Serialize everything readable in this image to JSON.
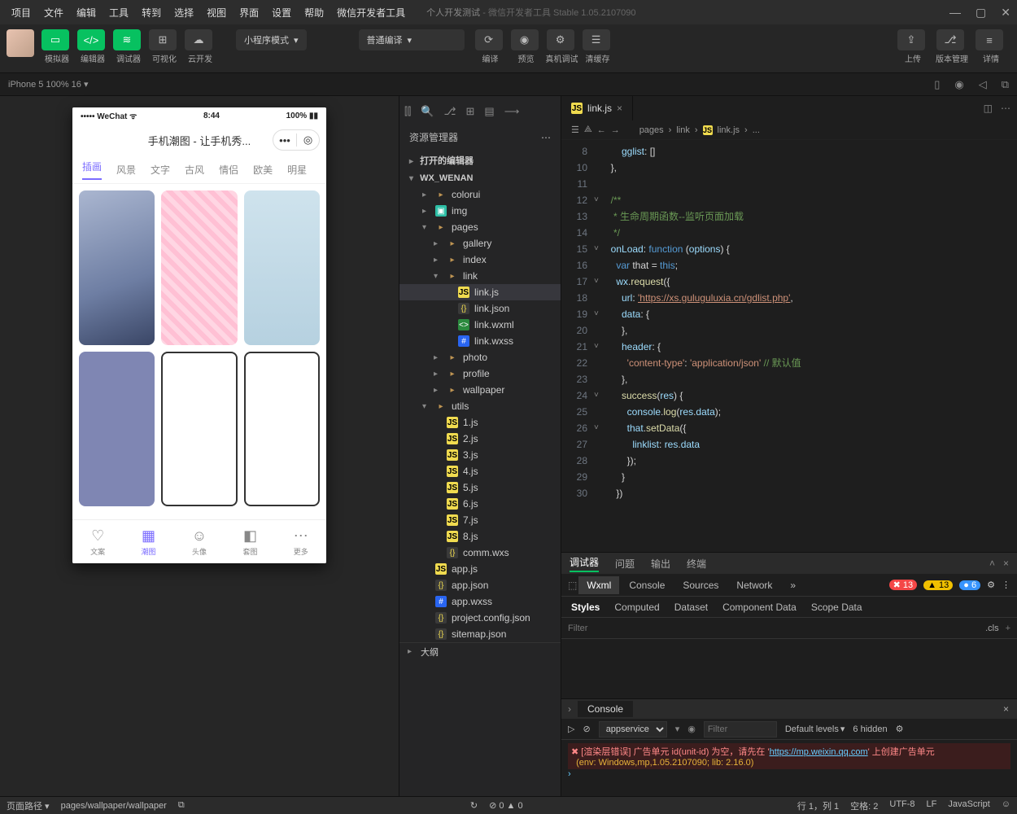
{
  "title": {
    "app": "个人开发测试",
    "suffix": " - 微信开发者工具 Stable 1.05.2107090"
  },
  "menu": [
    "项目",
    "文件",
    "编辑",
    "工具",
    "转到",
    "选择",
    "视图",
    "界面",
    "设置",
    "帮助",
    "微信开发者工具"
  ],
  "toolbar": {
    "sim": "模拟器",
    "editor": "编辑器",
    "debugger": "调试器",
    "viz": "可视化",
    "cloud": "云开发",
    "mode": "小程序模式",
    "compileMode": "普通编译",
    "compile": "编译",
    "preview": "预览",
    "realdev": "真机调试",
    "clear": "清缓存",
    "upload": "上传",
    "version": "版本管理",
    "details": "详情"
  },
  "device": {
    "label": "iPhone 5 100% 16"
  },
  "phone": {
    "carrier": "WeChat",
    "time": "8:44",
    "battery": "100%",
    "title": "手机潮图 - 让手机秀...",
    "tabs": [
      "插画",
      "风景",
      "文字",
      "古风",
      "情侣",
      "欧美",
      "明星"
    ],
    "tabbar": [
      {
        "icon": "♡",
        "label": "文案"
      },
      {
        "icon": "▦",
        "label": "潮图"
      },
      {
        "icon": "☺",
        "label": "头像"
      },
      {
        "icon": "◧",
        "label": "套图"
      },
      {
        "icon": "⋯",
        "label": "更多"
      }
    ]
  },
  "explorer": {
    "title": "资源管理器",
    "sections": {
      "openEditors": "打开的编辑器",
      "project": "WX_WENAN"
    },
    "tree": [
      {
        "d": 1,
        "t": "folder",
        "c": "▸",
        "n": "colorui"
      },
      {
        "d": 1,
        "t": "img",
        "c": "▸",
        "n": "img"
      },
      {
        "d": 1,
        "t": "folder",
        "c": "▾",
        "n": "pages"
      },
      {
        "d": 2,
        "t": "folder",
        "c": "▸",
        "n": "gallery"
      },
      {
        "d": 2,
        "t": "folder",
        "c": "▸",
        "n": "index"
      },
      {
        "d": 2,
        "t": "folder",
        "c": "▾",
        "n": "link"
      },
      {
        "d": 3,
        "t": "js",
        "n": "link.js",
        "sel": true
      },
      {
        "d": 3,
        "t": "json",
        "n": "link.json"
      },
      {
        "d": 3,
        "t": "wxml",
        "n": "link.wxml"
      },
      {
        "d": 3,
        "t": "wxss",
        "n": "link.wxss"
      },
      {
        "d": 2,
        "t": "folder",
        "c": "▸",
        "n": "photo"
      },
      {
        "d": 2,
        "t": "folder",
        "c": "▸",
        "n": "profile"
      },
      {
        "d": 2,
        "t": "folder",
        "c": "▸",
        "n": "wallpaper"
      },
      {
        "d": 1,
        "t": "folder",
        "c": "▾",
        "n": "utils"
      },
      {
        "d": 2,
        "t": "js",
        "n": "1.js"
      },
      {
        "d": 2,
        "t": "js",
        "n": "2.js"
      },
      {
        "d": 2,
        "t": "js",
        "n": "3.js"
      },
      {
        "d": 2,
        "t": "js",
        "n": "4.js"
      },
      {
        "d": 2,
        "t": "js",
        "n": "5.js"
      },
      {
        "d": 2,
        "t": "js",
        "n": "6.js"
      },
      {
        "d": 2,
        "t": "js",
        "n": "7.js"
      },
      {
        "d": 2,
        "t": "js",
        "n": "8.js"
      },
      {
        "d": 2,
        "t": "json",
        "n": "comm.wxs"
      },
      {
        "d": 1,
        "t": "js",
        "n": "app.js"
      },
      {
        "d": 1,
        "t": "json",
        "n": "app.json"
      },
      {
        "d": 1,
        "t": "wxss",
        "n": "app.wxss"
      },
      {
        "d": 1,
        "t": "json",
        "n": "project.config.json"
      },
      {
        "d": 1,
        "t": "json",
        "n": "sitemap.json"
      }
    ],
    "outline": "大纲"
  },
  "editor": {
    "tab": "link.js",
    "crumbs": [
      "pages",
      "link",
      "link.js",
      "..."
    ],
    "lines": [
      {
        "n": 8,
        "frag": [
          [
            "prop",
            "      gglist"
          ],
          [
            "punct",
            ": []"
          ]
        ]
      },
      {
        "n": 10,
        "frag": [
          [
            "punct",
            "  },"
          ]
        ]
      },
      {
        "n": 11,
        "frag": [
          [
            "punct",
            ""
          ]
        ]
      },
      {
        "n": 12,
        "frag": [
          [
            "comment",
            "  /**"
          ]
        ]
      },
      {
        "n": 13,
        "frag": [
          [
            "comment",
            "   * 生命周期函数--监听页面加载"
          ]
        ]
      },
      {
        "n": 14,
        "frag": [
          [
            "comment",
            "   */"
          ]
        ]
      },
      {
        "n": 15,
        "frag": [
          [
            "prop",
            "  onLoad"
          ],
          [
            "punct",
            ": "
          ],
          [
            "key",
            "function"
          ],
          [
            "punct",
            " ("
          ],
          [
            "prop",
            "options"
          ],
          [
            "punct",
            ") {"
          ]
        ]
      },
      {
        "n": 16,
        "frag": [
          [
            "key",
            "    var"
          ],
          [
            "punct",
            " that = "
          ],
          [
            "key",
            "this"
          ],
          [
            "punct",
            ";"
          ]
        ]
      },
      {
        "n": 17,
        "frag": [
          [
            "prop",
            "    wx"
          ],
          [
            "punct",
            "."
          ],
          [
            "func",
            "request"
          ],
          [
            "punct",
            "({"
          ]
        ]
      },
      {
        "n": 18,
        "frag": [
          [
            "prop",
            "      url"
          ],
          [
            "punct",
            ": "
          ],
          [
            "url",
            "'https://xs.guluguluxia.cn/gdlist.php'"
          ],
          [
            "punct",
            ","
          ]
        ]
      },
      {
        "n": 19,
        "frag": [
          [
            "prop",
            "      data"
          ],
          [
            "punct",
            ": {"
          ]
        ]
      },
      {
        "n": 20,
        "frag": [
          [
            "punct",
            "      },"
          ]
        ]
      },
      {
        "n": 21,
        "frag": [
          [
            "prop",
            "      header"
          ],
          [
            "punct",
            ": {"
          ]
        ]
      },
      {
        "n": 22,
        "frag": [
          [
            "str",
            "        'content-type'"
          ],
          [
            "punct",
            ": "
          ],
          [
            "str",
            "'application/json'"
          ],
          [
            "comment",
            " // 默认值"
          ]
        ]
      },
      {
        "n": 23,
        "frag": [
          [
            "punct",
            "      },"
          ]
        ]
      },
      {
        "n": 24,
        "frag": [
          [
            "func",
            "      success"
          ],
          [
            "punct",
            "("
          ],
          [
            "prop",
            "res"
          ],
          [
            "punct",
            ") {"
          ]
        ]
      },
      {
        "n": 25,
        "frag": [
          [
            "prop",
            "        console"
          ],
          [
            "punct",
            "."
          ],
          [
            "func",
            "log"
          ],
          [
            "punct",
            "("
          ],
          [
            "prop",
            "res"
          ],
          [
            "punct",
            "."
          ],
          [
            "prop",
            "data"
          ],
          [
            "punct",
            ");"
          ]
        ]
      },
      {
        "n": 26,
        "frag": [
          [
            "prop",
            "        that"
          ],
          [
            "punct",
            "."
          ],
          [
            "func",
            "setData"
          ],
          [
            "punct",
            "({"
          ]
        ]
      },
      {
        "n": 27,
        "frag": [
          [
            "prop",
            "          linklist"
          ],
          [
            "punct",
            ": "
          ],
          [
            "prop",
            "res"
          ],
          [
            "punct",
            "."
          ],
          [
            "prop",
            "data"
          ]
        ]
      },
      {
        "n": 28,
        "frag": [
          [
            "punct",
            "        });"
          ]
        ]
      },
      {
        "n": 29,
        "frag": [
          [
            "punct",
            "      }"
          ]
        ]
      },
      {
        "n": 30,
        "frag": [
          [
            "punct",
            "    })"
          ]
        ]
      }
    ]
  },
  "debugger": {
    "header": [
      "调试器",
      "问题",
      "输出",
      "终端"
    ],
    "devtabs": [
      "Wxml",
      "Console",
      "Sources",
      "Network"
    ],
    "badges": {
      "err": "13",
      "warn": "13",
      "info": "6"
    },
    "styleTabs": [
      "Styles",
      "Computed",
      "Dataset",
      "Component Data",
      "Scope Data"
    ],
    "filterPlaceholder": "Filter",
    "cls": ".cls",
    "consoleTab": "Console",
    "context": "appservice",
    "levels": "Default levels",
    "hidden": "6 hidden",
    "error": {
      "prefix": "[渲染层错误] 广告单元 id(unit-id) 为空，请先在 '",
      "link": "https://mp.weixin.qq.com",
      "suffix": "' 上创建广告单元",
      "env": "(env: Windows,mp,1.05.2107090; lib: 2.16.0)"
    }
  },
  "status": {
    "pathLabel": "页面路径",
    "path": "pages/wallpaper/wallpaper",
    "warn": "0",
    "err": "0",
    "pos": "行 1，列 1",
    "spaces": "空格: 2",
    "enc": "UTF-8",
    "eol": "LF",
    "lang": "JavaScript"
  }
}
